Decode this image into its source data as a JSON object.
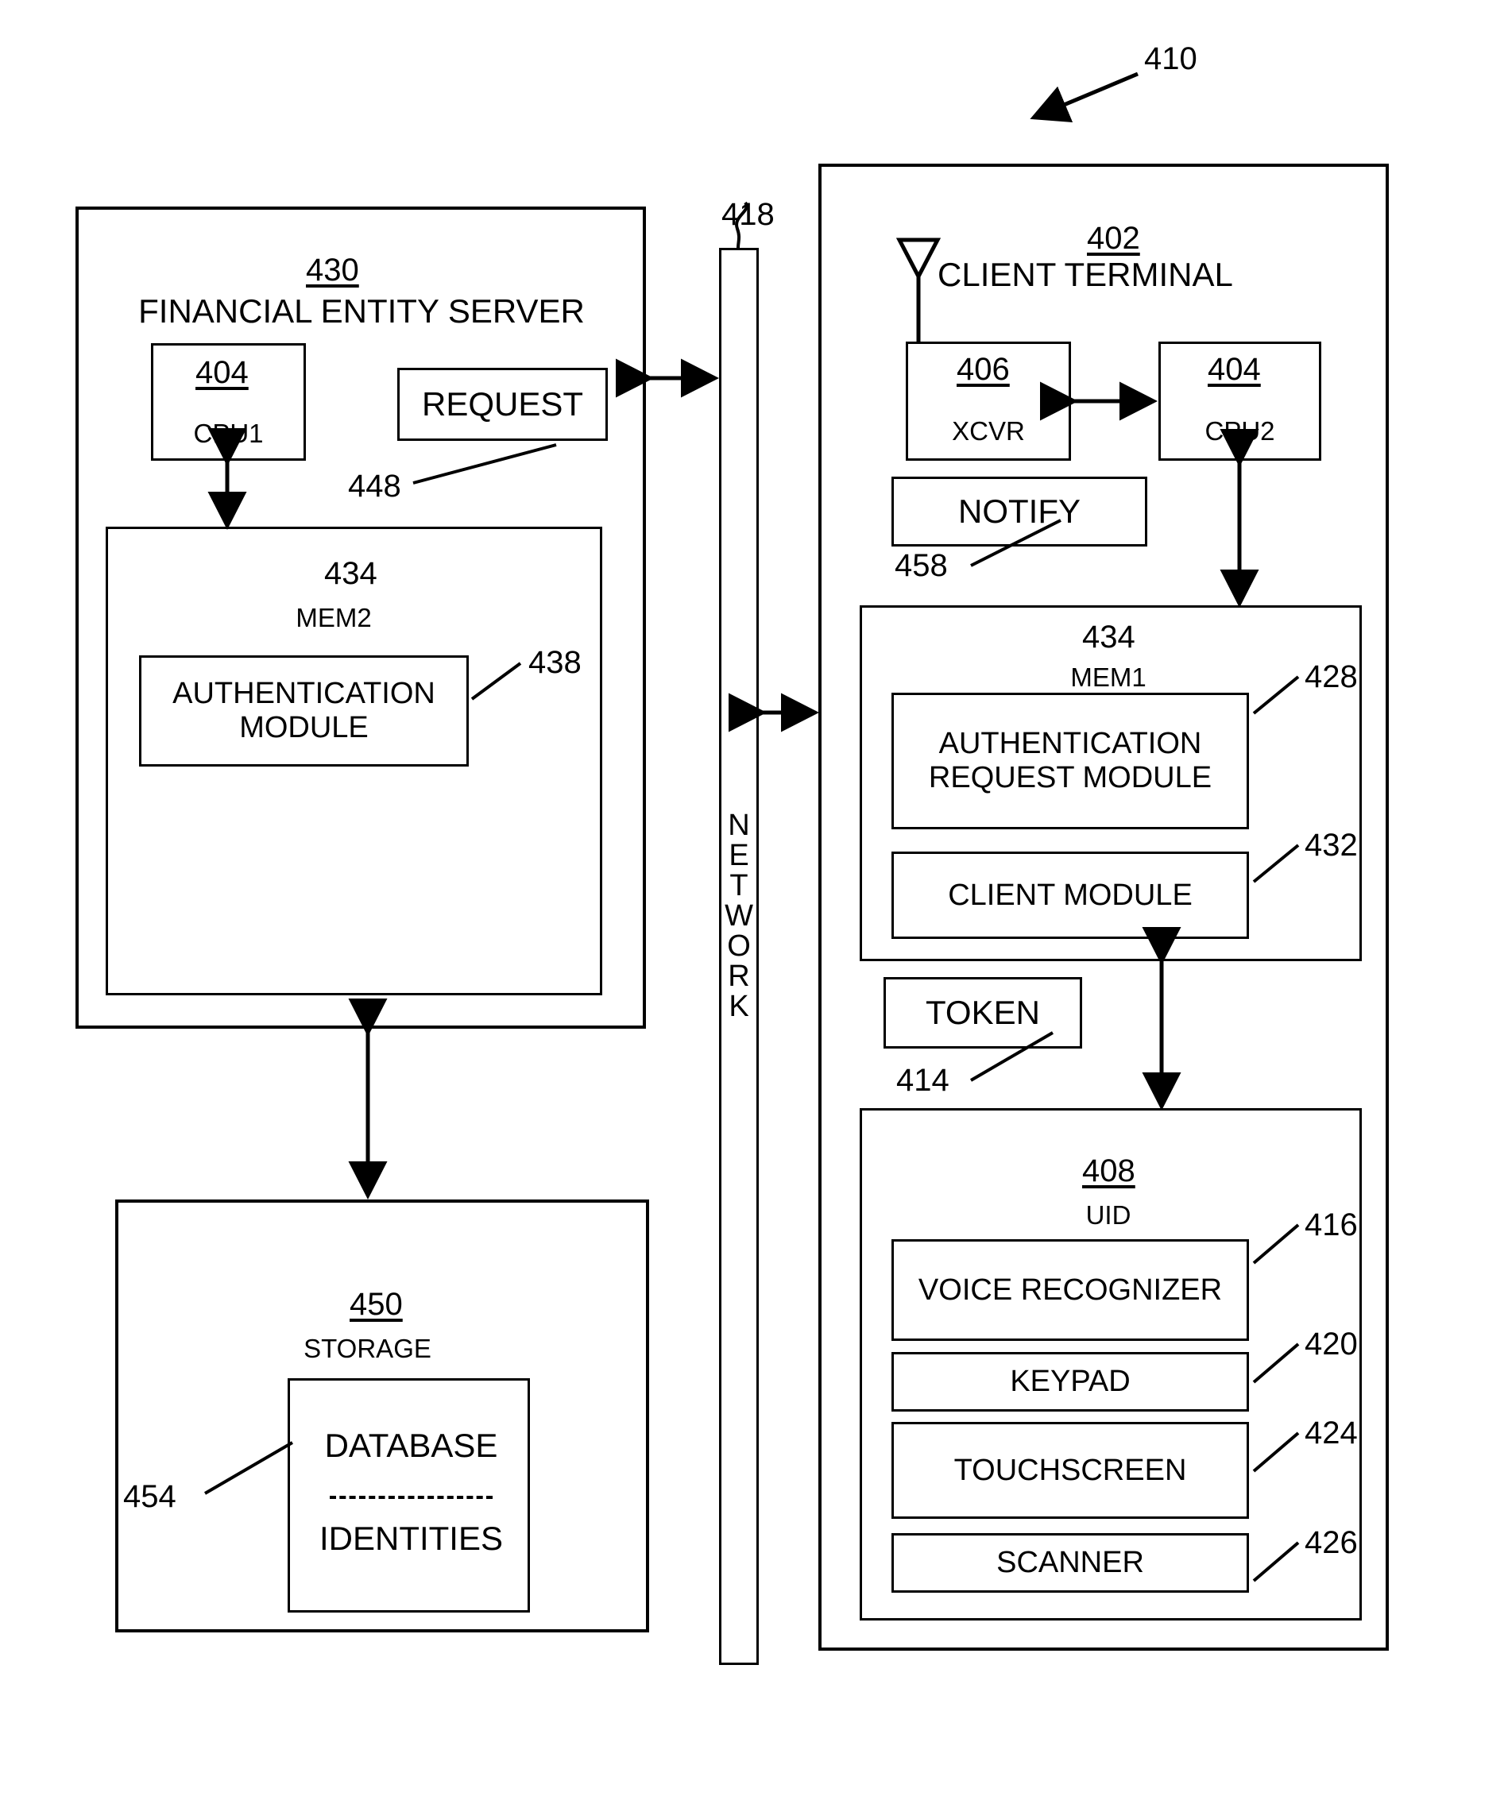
{
  "figure": {
    "overall_ref": "410",
    "network": {
      "ref": "418",
      "label_chars": [
        "N",
        "E",
        "T",
        "W",
        "O",
        "R",
        "K"
      ],
      "label": "NETWORK"
    },
    "server": {
      "ref": "430",
      "title": "FINANCIAL ENTITY SERVER",
      "cpu": {
        "ref": "404",
        "label": "CPU1"
      },
      "request": {
        "ref": "448",
        "label": "REQUEST"
      },
      "memory": {
        "ref": "434",
        "label": "MEM2",
        "module": {
          "ref": "438",
          "label": "AUTHENTICATION\nMODULE"
        }
      }
    },
    "storage": {
      "ref": "450",
      "title": "STORAGE",
      "database": {
        "ref": "454",
        "line1": "DATABASE",
        "separator": "-------------",
        "line2": "IDENTITIES"
      }
    },
    "client": {
      "ref": "402",
      "title": "CLIENT TERMINAL",
      "antenna_icon": "antenna-icon",
      "xcvr": {
        "ref": "406",
        "label": "XCVR"
      },
      "cpu": {
        "ref": "404",
        "label": "CPU2"
      },
      "notify": {
        "ref": "458",
        "label": "NOTIFY"
      },
      "memory": {
        "ref": "434",
        "label": "MEM1",
        "auth_request_module": {
          "ref": "428",
          "label": "AUTHENTICATION\nREQUEST\nMODULE"
        },
        "client_module": {
          "ref": "432",
          "label": "CLIENT MODULE"
        }
      },
      "token": {
        "ref": "414",
        "label": "TOKEN"
      },
      "uid": {
        "ref": "408",
        "title": "UID",
        "components": [
          {
            "ref": "416",
            "label": "VOICE\nRECOGNIZER"
          },
          {
            "ref": "420",
            "label": "KEYPAD"
          },
          {
            "ref": "424",
            "label": "TOUCHSCREEN"
          },
          {
            "ref": "426",
            "label": "SCANNER"
          }
        ]
      }
    }
  }
}
